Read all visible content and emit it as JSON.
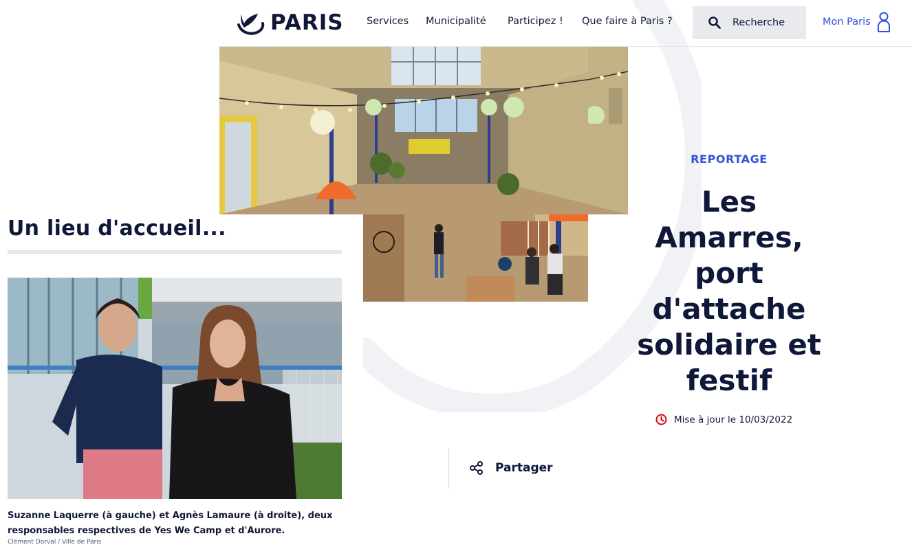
{
  "header": {
    "logo_text": "PARIS",
    "nav": [
      "Services",
      "Municipalité",
      "Participez !",
      "Que faire à Paris ?"
    ],
    "search_label": "Recherche",
    "account_label": "Mon Paris"
  },
  "left_panel": {
    "heading": "Un lieu d'accueil...",
    "caption": "Suzanne Laquerre (à gauche) et Agnès Lamaure (à droite), deux responsables respectives de Yes We Camp et d'Aurore.",
    "credit": "Clément Dorval / Ville de Paris"
  },
  "article": {
    "kicker": "REPORTAGE",
    "title_lines": [
      "Les",
      "Amarres,",
      "port",
      "d'attache",
      "solidaire et",
      "festif"
    ],
    "updated": "Mise à jour le 10/03/2022",
    "share_label": "Partager"
  },
  "colors": {
    "navy": "#10183a",
    "accent_blue": "#3652d9",
    "clock_red": "#e1000f",
    "search_bg": "#e9eaed"
  },
  "icons": [
    "paris-logo-icon",
    "search-icon",
    "user-icon",
    "clock-icon",
    "share-icon"
  ]
}
